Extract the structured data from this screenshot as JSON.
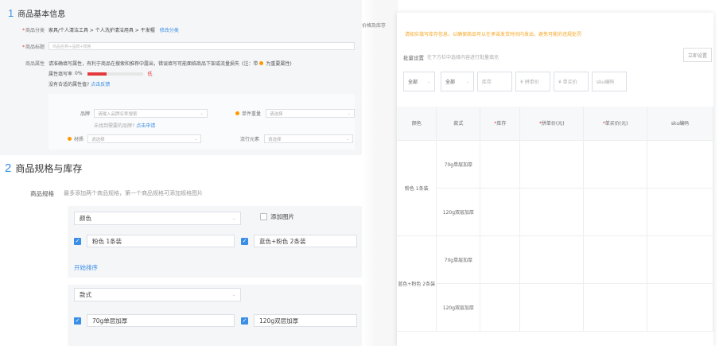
{
  "basic": {
    "num": "1",
    "title": "商品基本信息",
    "category_label": "商品分类",
    "category_value": "家具/个人清洁工具 > 个人洗护清洁用具 > 干发帽",
    "category_link": "修改分类",
    "title_label": "商品标题",
    "title_placeholder": "商品名称+品牌+规格",
    "attr_label": "商品属性",
    "attr_hint": "请准确填写属性，有利于商品在搜索和推荐中露出，错误填写可能面临商品下架或流量损失",
    "attr_note": "(注：带",
    "attr_note_key": "为重要属性)",
    "fill_rate_label": "属性填写率",
    "fill_rate": "0%",
    "fill_level": 0.35,
    "fill_status": "低",
    "missing_attr": "没有合适的属性值?",
    "missing_attr_link": "点击反馈",
    "brand_label": "品牌",
    "brand_placeholder": "请输入品牌名称搜索",
    "brand_missing": "未找到需要的品牌?",
    "brand_link": "点击申请",
    "weight_label": "单件重量",
    "weight_placeholder": "请选择",
    "material_label": "材质",
    "material_placeholder": "请选择",
    "element_label": "流行元素",
    "element_placeholder": "请选择"
  },
  "specs": {
    "num": "2",
    "title": "商品规格与库存",
    "label": "商品规格",
    "hint": "最多添加两个商品规格，第一个商品规格可添加规格图片",
    "group1": {
      "name": "颜色",
      "add_image": "添加图片",
      "values": [
        "粉色 1条装",
        "蓝色+粉色 2条装"
      ],
      "sort_link": "开始排序"
    },
    "group2": {
      "name": "款式",
      "values": [
        "70g单层加厚",
        "120g双层加厚"
      ]
    }
  },
  "price_section": {
    "label": "价格及库存",
    "warning": "请如实填写库存信息，以确保商品可以在承诺发货时间内发出，避免可能的违规处罚",
    "bulk_label": "批量设置",
    "bulk_hint": "在下方栏中选择内容进行批量填充",
    "bulk_button": "立即设置",
    "filters": [
      "全部",
      "全部"
    ],
    "inputs": [
      "库存",
      "¥ 拼单价",
      "¥ 单买价",
      "sku编码"
    ],
    "columns": [
      "颜色",
      "款式",
      "库存",
      "拼单价(元)",
      "单买价(元)",
      "sku编码"
    ],
    "rows": [
      {
        "color": "粉色 1条装",
        "style": "70g单层加厚"
      },
      {
        "color": "",
        "style": "120g双层加厚"
      },
      {
        "color": "蓝色+粉色 2条装",
        "style": "70g单层加厚"
      },
      {
        "color": "",
        "style": "120g双层加厚"
      }
    ]
  },
  "colors": {
    "accent": "#3a8ee6",
    "warning": "#f5a623",
    "required": "#e4393c"
  }
}
